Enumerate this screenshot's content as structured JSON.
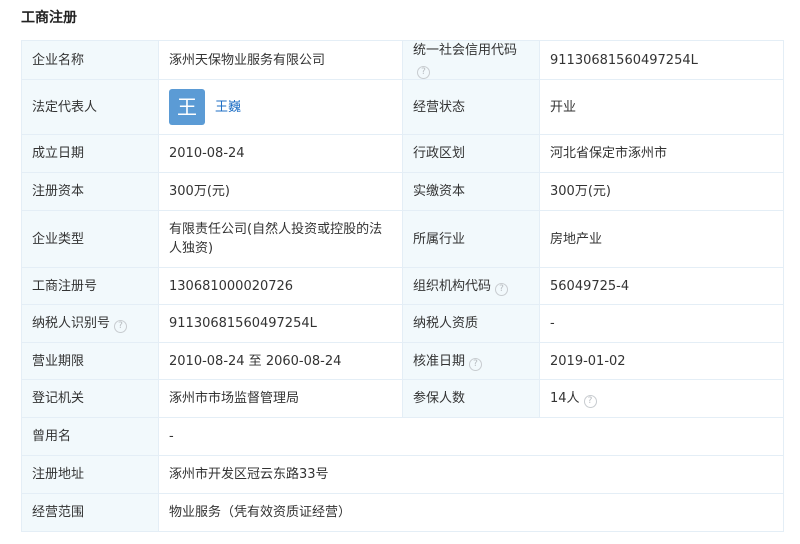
{
  "section_title": "工商注册",
  "company_name": {
    "label": "企业名称",
    "value": "涿州天保物业服务有限公司"
  },
  "credit_code": {
    "label": "统一社会信用代码",
    "value": "91130681560497254L"
  },
  "legal_rep": {
    "label": "法定代表人",
    "avatar_char": "王",
    "name": "王巍"
  },
  "status": {
    "label": "经营状态",
    "value": "开业"
  },
  "founded": {
    "label": "成立日期",
    "value": "2010-08-24"
  },
  "region": {
    "label": "行政区划",
    "value": "河北省保定市涿州市"
  },
  "reg_capital": {
    "label": "注册资本",
    "value": "300万(元)"
  },
  "paid_capital": {
    "label": "实缴资本",
    "value": "300万(元)"
  },
  "company_type": {
    "label": "企业类型",
    "value": "有限责任公司(自然人投资或控股的法人独资)"
  },
  "industry": {
    "label": "所属行业",
    "value": "房地产业"
  },
  "reg_no": {
    "label": "工商注册号",
    "value": "130681000020726"
  },
  "org_code": {
    "label": "组织机构代码",
    "value": "56049725-4"
  },
  "taxpayer_id": {
    "label": "纳税人识别号",
    "value": "91130681560497254L"
  },
  "taxpayer_qual": {
    "label": "纳税人资质",
    "value": "-"
  },
  "term": {
    "label": "营业期限",
    "value": "2010-08-24 至 2060-08-24"
  },
  "approval_date": {
    "label": "核准日期",
    "value": "2019-01-02"
  },
  "authority": {
    "label": "登记机关",
    "value": "涿州市市场监督管理局"
  },
  "insured": {
    "label": "参保人数",
    "value": "14人"
  },
  "former_name": {
    "label": "曾用名",
    "value": "-"
  },
  "address": {
    "label": "注册地址",
    "value": "涿州市开发区冠云东路33号"
  },
  "scope": {
    "label": "经营范围",
    "value": "物业服务（凭有效资质证经营）"
  },
  "help_glyph": "?",
  "colors": {
    "label_bg": "#f2f9fc",
    "border": "#e4eef6",
    "link": "#1f6fc5",
    "avatar_bg": "#5b9bd5"
  }
}
